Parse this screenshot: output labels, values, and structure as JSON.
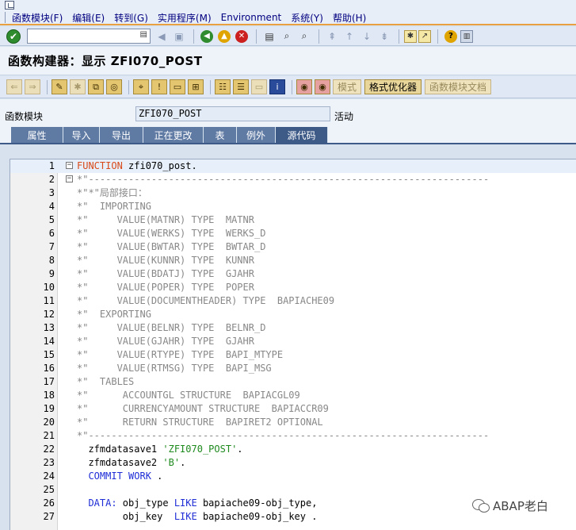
{
  "menu": [
    "函数模块(F)",
    "编辑(E)",
    "转到(G)",
    "实用程序(M)",
    "Environment",
    "系统(Y)",
    "帮助(H)"
  ],
  "command_field": {
    "value": ""
  },
  "page_title": "函数构建器：显示 ZFI070_POST",
  "app_toolbar": {
    "btn_mode": "模式",
    "btn_pretty_printer": "格式优化器",
    "btn_fm_doc": "函数模块文档"
  },
  "field": {
    "label": "函数模块",
    "value": "ZFI070_POST",
    "status": "活动"
  },
  "tabs": [
    "属性",
    "导入",
    "导出",
    "正在更改",
    "表",
    "例外",
    "源代码"
  ],
  "active_tab": "源代码",
  "code_lines": [
    {
      "n": "1",
      "text": "FUNCTION zfi070_post."
    },
    {
      "n": "2",
      "text": "*\"----------------------------------------------------------------------"
    },
    {
      "n": "3",
      "text": "*\"*\"局部接口："
    },
    {
      "n": "4",
      "text": "*\"  IMPORTING"
    },
    {
      "n": "5",
      "text": "*\"     VALUE(MATNR) TYPE  MATNR"
    },
    {
      "n": "6",
      "text": "*\"     VALUE(WERKS) TYPE  WERKS_D"
    },
    {
      "n": "7",
      "text": "*\"     VALUE(BWTAR) TYPE  BWTAR_D"
    },
    {
      "n": "8",
      "text": "*\"     VALUE(KUNNR) TYPE  KUNNR"
    },
    {
      "n": "9",
      "text": "*\"     VALUE(BDATJ) TYPE  GJAHR"
    },
    {
      "n": "10",
      "text": "*\"     VALUE(POPER) TYPE  POPER"
    },
    {
      "n": "11",
      "text": "*\"     VALUE(DOCUMENTHEADER) TYPE  BAPIACHE09"
    },
    {
      "n": "12",
      "text": "*\"  EXPORTING"
    },
    {
      "n": "13",
      "text": "*\"     VALUE(BELNR) TYPE  BELNR_D"
    },
    {
      "n": "14",
      "text": "*\"     VALUE(GJAHR) TYPE  GJAHR"
    },
    {
      "n": "15",
      "text": "*\"     VALUE(RTYPE) TYPE  BAPI_MTYPE"
    },
    {
      "n": "16",
      "text": "*\"     VALUE(RTMSG) TYPE  BAPI_MSG"
    },
    {
      "n": "17",
      "text": "*\"  TABLES"
    },
    {
      "n": "18",
      "text": "*\"      ACCOUNTGL STRUCTURE  BAPIACGL09"
    },
    {
      "n": "19",
      "text": "*\"      CURRENCYAMOUNT STRUCTURE  BAPIACCR09"
    },
    {
      "n": "20",
      "text": "*\"      RETURN STRUCTURE  BAPIRET2 OPTIONAL"
    },
    {
      "n": "21",
      "text": "*\"----------------------------------------------------------------------"
    },
    {
      "n": "22",
      "text": "  zfmdatasave1 'ZFI070_POST'."
    },
    {
      "n": "23",
      "text": "  zfmdatasave2 'B'."
    },
    {
      "n": "24",
      "text": "  COMMIT WORK ."
    },
    {
      "n": "25",
      "text": ""
    },
    {
      "n": "26",
      "text": "  DATA: obj_type LIKE bapiache09-obj_type,"
    },
    {
      "n": "27",
      "text": "        obj_key  LIKE bapiache09-obj_key ."
    }
  ],
  "watermark": "ABAP老白",
  "icons": {
    "ok": "check-icon",
    "back": "back-arrow-icon",
    "save": "save-icon",
    "exit": "exit-icon",
    "cancel": "cancel-icon",
    "print": "print-icon",
    "find": "find-icon",
    "find_next": "find-next-icon",
    "help": "help-icon"
  },
  "colors": {
    "keyword": "#1f2dd6",
    "function_keyword": "#d94a1a",
    "string": "#1e8a1e",
    "comment": "#888888",
    "tab_active": "#3e5b88",
    "tab": "#5f7aa3"
  }
}
